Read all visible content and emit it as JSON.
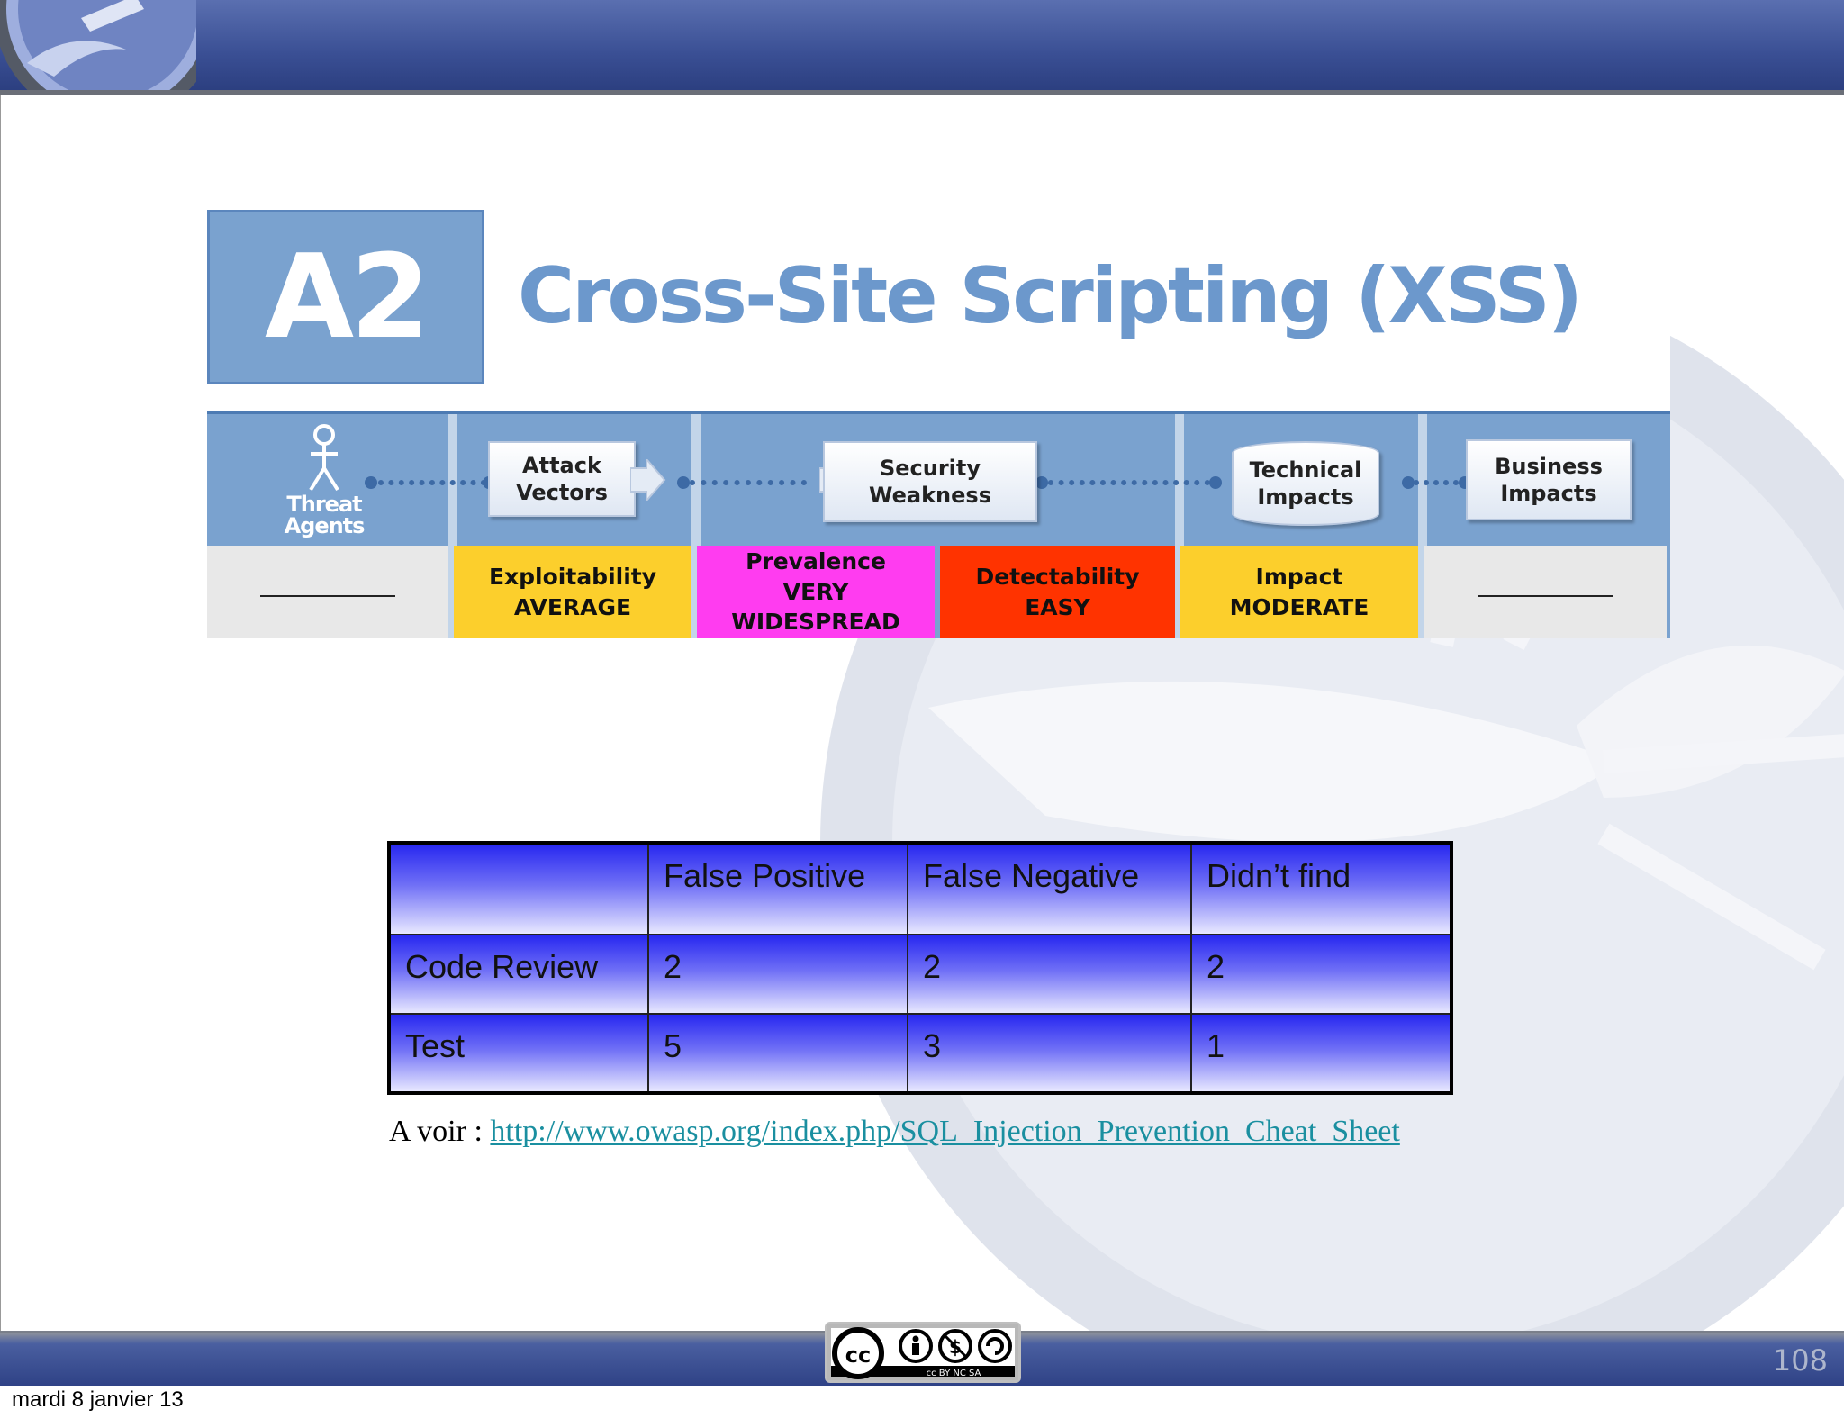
{
  "slide": {
    "a2_code": "A2",
    "a2_title": "Cross-Site Scripting (XSS)",
    "flow": {
      "threat_agents": "Threat\nAgents",
      "attack_vectors": "Attack\nVectors",
      "security_weakness": "Security\nWeakness",
      "technical_impacts": "Technical\nImpacts",
      "business_impacts": "Business\nImpacts"
    },
    "ratings": [
      {
        "label": "",
        "value": "",
        "color": "#e8e8e8"
      },
      {
        "label": "Exploitability",
        "value": "AVERAGE",
        "color": "#fccf2c"
      },
      {
        "label": "Prevalence",
        "value": "VERY WIDESPREAD",
        "color": "#ff3cf0"
      },
      {
        "label": "Detectability",
        "value": "EASY",
        "color": "#ff3300"
      },
      {
        "label": "Impact",
        "value": "MODERATE",
        "color": "#fccf2c"
      },
      {
        "label": "",
        "value": "",
        "color": "#e8e8e8"
      }
    ],
    "table": {
      "headers": [
        "",
        "False Positive",
        "False Negative",
        "Didn’t find"
      ],
      "rows": [
        [
          "Code Review",
          "2",
          "2",
          "2"
        ],
        [
          "Test",
          "5",
          "3",
          "1"
        ]
      ]
    },
    "link_prefix": "A voir : ",
    "link_text": "http://www.owasp.org/index.php/SQL_Injection_Prevention_Cheat_Sheet",
    "license_badge": "cc BY NC SA",
    "page_number": "108"
  },
  "footer": {
    "date": "mardi 8 janvier 13"
  }
}
